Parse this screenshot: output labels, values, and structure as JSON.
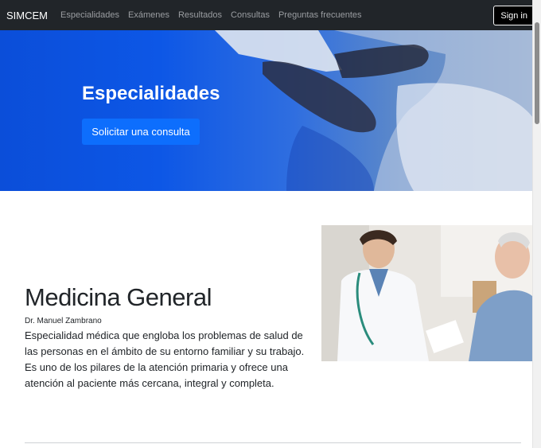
{
  "navbar": {
    "brand": "SIMCEM",
    "links": [
      "Especialidades",
      "Exámenes",
      "Resultados",
      "Consultas",
      "Preguntas frecuentes"
    ],
    "sign_in": "Sign in"
  },
  "hero": {
    "title": "Especialidades",
    "button": "Solicitar una consulta"
  },
  "specialty": {
    "title": "Medicina General",
    "doctor": "Dr. Manuel Zambrano",
    "description": "Especialidad médica que engloba los problemas de salud de las personas en el ámbito de su entorno familiar y su trabajo. Es uno de los pilares de la atención primaria y ofrece una atención al paciente más cercana, integral y completa."
  }
}
